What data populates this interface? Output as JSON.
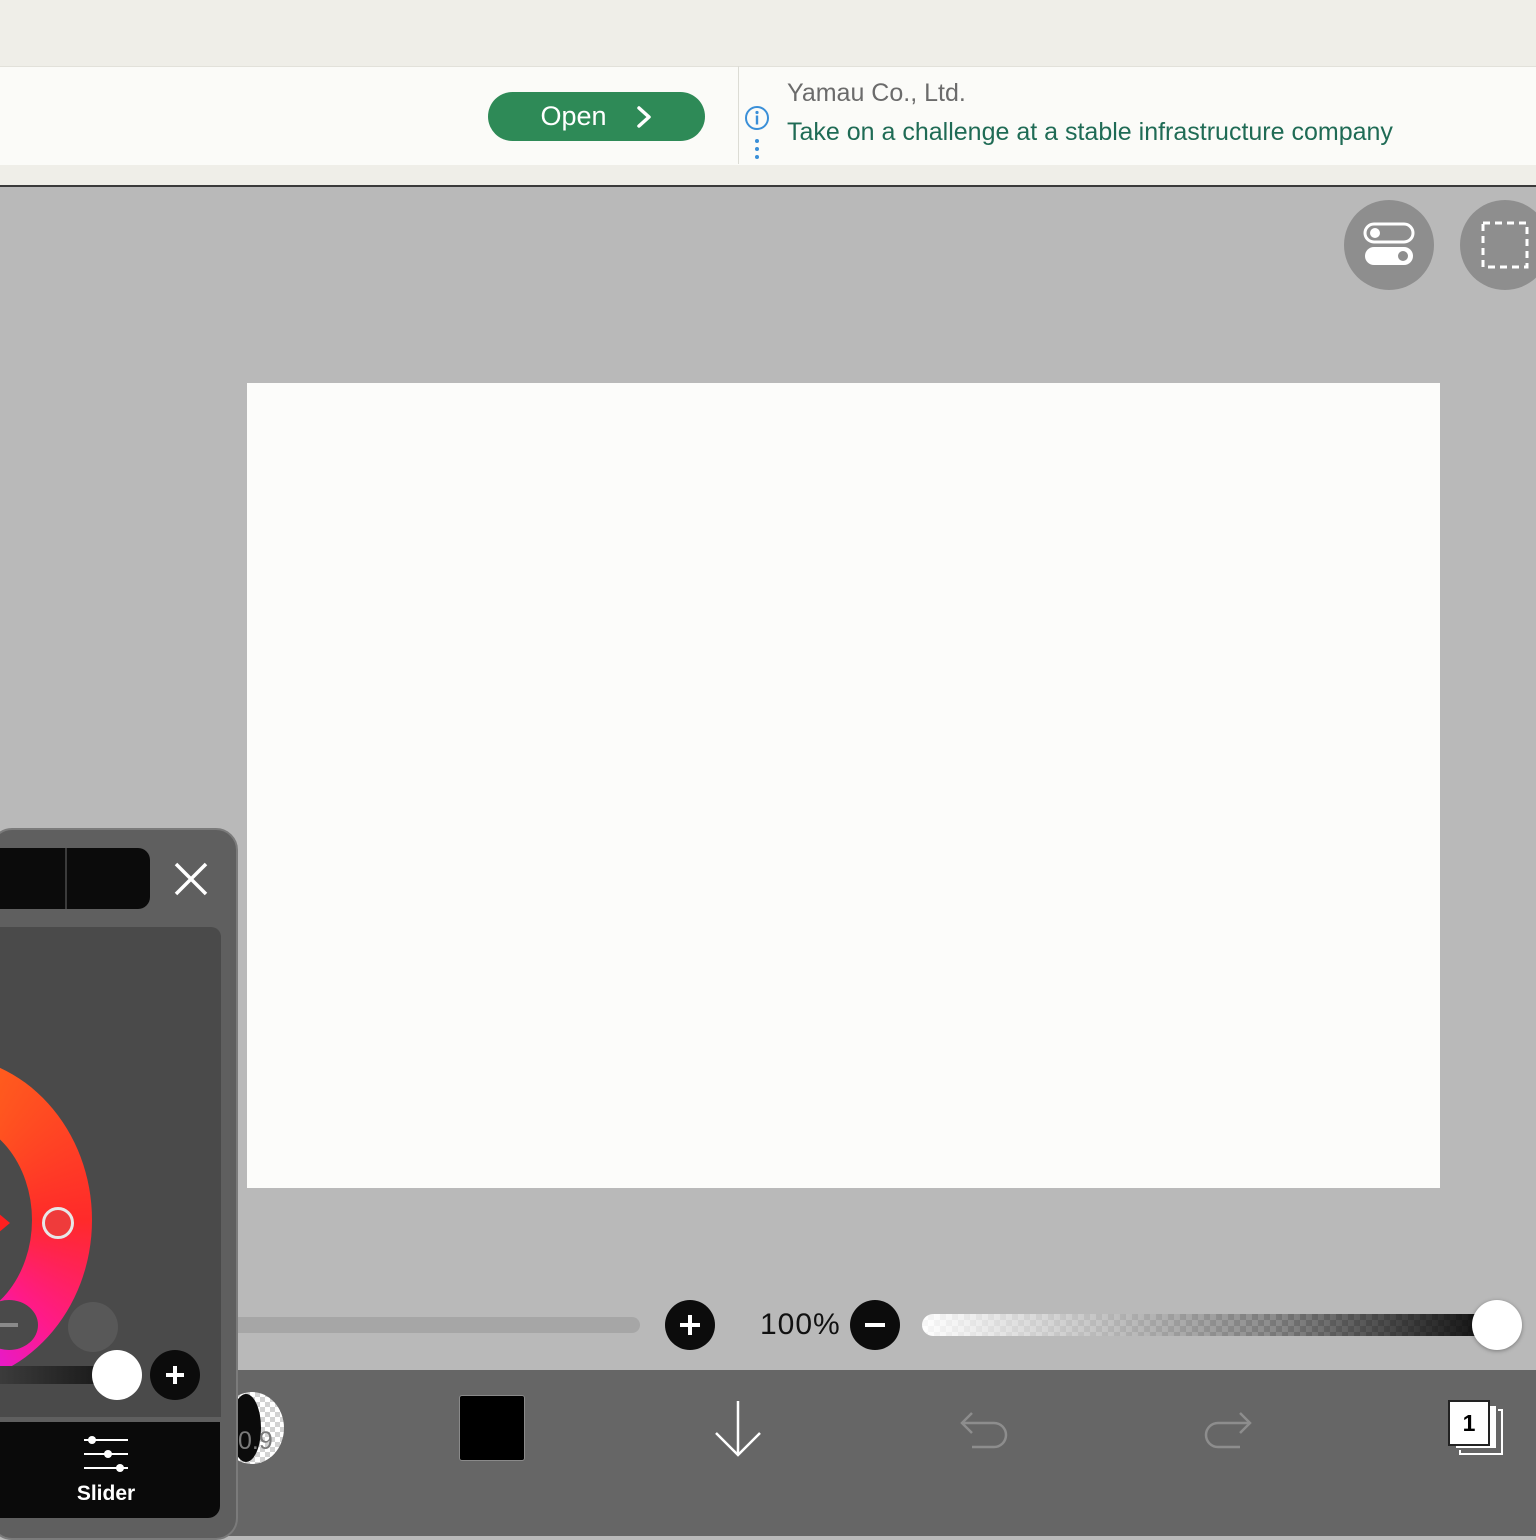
{
  "ad": {
    "open_label": "Open",
    "company": "Yamau Co., Ltd.",
    "tagline": "Take on a challenge at a stable infrastructure company",
    "icons": [
      "chevron-right-icon",
      "info-icon",
      "more-vertical-icon"
    ],
    "button_color": "#2e8a57",
    "tagline_color": "#1f6b55"
  },
  "top_controls": {
    "icons": [
      "toggle-settings-icon",
      "selection-icon"
    ]
  },
  "canvas": {
    "background": "#fcfcfa"
  },
  "zoom": {
    "label": "100%",
    "icons": [
      "plus-icon",
      "minus-icon"
    ]
  },
  "opacity": {
    "level": 1.0
  },
  "toolbar": {
    "brush_size": "0.9",
    "color": "#000000",
    "layers_count": "1",
    "icons": [
      "download-arrow-icon",
      "undo-icon",
      "redo-icon",
      "layers-icon"
    ]
  },
  "color_panel": {
    "tab_label": "Slider",
    "selected_color": "#ef3b3b",
    "icons": [
      "close-icon",
      "color-wheel",
      "sliders-icon",
      "minus-icon",
      "plus-icon"
    ]
  }
}
